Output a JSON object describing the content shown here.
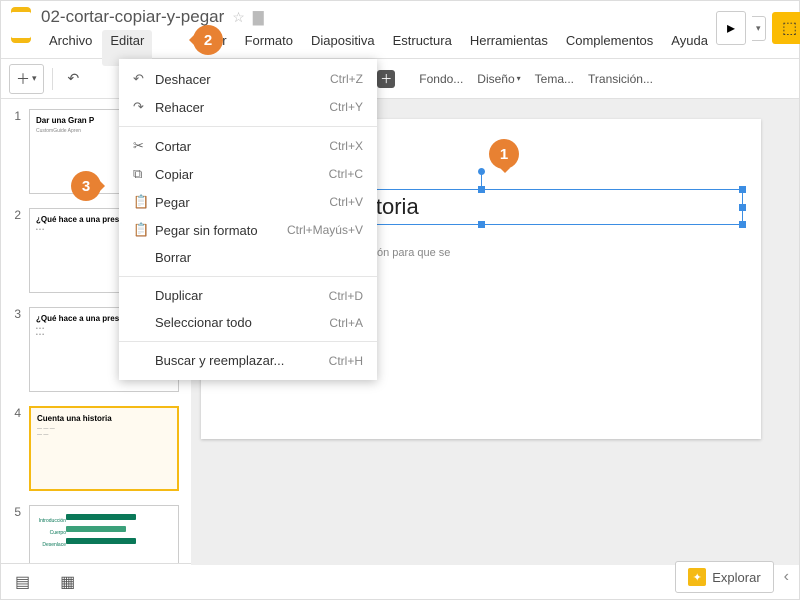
{
  "doc": {
    "title": "02-cortar-copiar-y-pegar"
  },
  "menus": [
    "Archivo",
    "Editar",
    "",
    "",
    "ertar",
    "Formato",
    "Diapositiva",
    "Estructura",
    "Herramientas",
    "Complementos",
    "Ayuda"
  ],
  "menu_simple": {
    "archivo": "Archivo",
    "editar": "Editar",
    "insertar_tail": "ertar",
    "formato": "Formato",
    "diapositiva": "Diapositiva",
    "estructura": "Estructura",
    "herramientas": "Herramientas",
    "complementos": "Complementos",
    "ayuda": "Ayuda"
  },
  "toolbar_right": {
    "fondo": "Fondo...",
    "diseno": "Diseño",
    "tema": "Tema...",
    "transicion": "Transición..."
  },
  "dropdown": [
    {
      "icon": "↶",
      "label": "Deshacer",
      "shortcut": "Ctrl+Z"
    },
    {
      "icon": "↷",
      "label": "Rehacer",
      "shortcut": "Ctrl+Y"
    },
    {
      "sep": true
    },
    {
      "icon": "✂",
      "label": "Cortar",
      "shortcut": "Ctrl+X"
    },
    {
      "icon": "⧉",
      "label": "Copiar",
      "shortcut": "Ctrl+C"
    },
    {
      "icon": "📋",
      "label": "Pegar",
      "shortcut": "Ctrl+V"
    },
    {
      "icon": "📋",
      "label": "Pegar sin formato",
      "shortcut": "Ctrl+Mayús+V"
    },
    {
      "icon": "",
      "label": "Borrar",
      "shortcut": ""
    },
    {
      "sep": true
    },
    {
      "icon": "",
      "label": "Duplicar",
      "shortcut": "Ctrl+D"
    },
    {
      "icon": "",
      "label": "Seleccionar todo",
      "shortcut": "Ctrl+A"
    },
    {
      "sep": true
    },
    {
      "icon": "",
      "label": "Buscar y reemplazar...",
      "shortcut": "Ctrl+H"
    }
  ],
  "dd": {
    "deshacer": {
      "l": "Deshacer",
      "s": "Ctrl+Z"
    },
    "rehacer": {
      "l": "Rehacer",
      "s": "Ctrl+Y"
    },
    "cortar": {
      "l": "Cortar",
      "s": "Ctrl+X"
    },
    "copiar": {
      "l": "Copiar",
      "s": "Ctrl+C"
    },
    "pegar": {
      "l": "Pegar",
      "s": "Ctrl+V"
    },
    "pegarsin": {
      "l": "Pegar sin formato",
      "s": "Ctrl+Mayús+V"
    },
    "borrar": {
      "l": "Borrar",
      "s": ""
    },
    "duplicar": {
      "l": "Duplicar",
      "s": "Ctrl+D"
    },
    "seleccionar": {
      "l": "Seleccionar todo",
      "s": "Ctrl+A"
    },
    "buscar": {
      "l": "Buscar y reemplazar...",
      "s": "Ctrl+H"
    }
  },
  "thumbs": {
    "n1": "1",
    "n2": "2",
    "n3": "3",
    "n4": "4",
    "n5": "5",
    "t1": {
      "title": "Dar una Gran P",
      "sub": "CustomGuide Apren"
    },
    "t2": {
      "title": "¿Qué hace a una presentaci"
    },
    "t3": {
      "title": "¿Qué hace a una presentaci"
    },
    "t4": {
      "title": "Cuenta una historia"
    },
    "t5": {
      "a": "Introducción",
      "b": "Cuerpo",
      "c": "Desenlace"
    }
  },
  "slide": {
    "title_visible": "istoria",
    "sub_visible": "ón para que se"
  },
  "explore": {
    "label": "Explorar"
  },
  "callouts": {
    "c1": "1",
    "c2": "2",
    "c3": "3"
  }
}
